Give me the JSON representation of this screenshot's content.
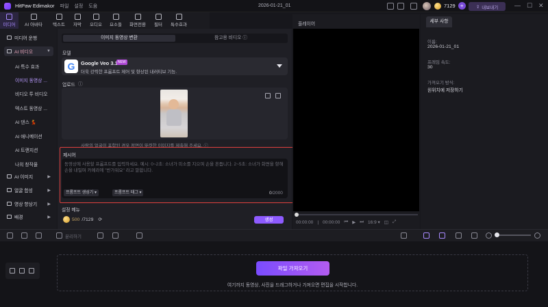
{
  "titlebar": {
    "app_name": "HitPaw Edimakor",
    "menu": [
      "파일",
      "설정",
      "도움"
    ],
    "project_date": "2026-01-21_01",
    "credits": "7129",
    "export_label": "내보내기"
  },
  "toolbar": {
    "items": [
      {
        "label": "미디어",
        "icon": "media-icon",
        "active": true
      },
      {
        "label": "AI 아바타",
        "icon": "avatar-icon"
      },
      {
        "label": "텍스트",
        "icon": "text-icon"
      },
      {
        "label": "자막",
        "icon": "subtitle-icon"
      },
      {
        "label": "오디오",
        "icon": "audio-icon"
      },
      {
        "label": "요소들",
        "icon": "elements-icon"
      },
      {
        "label": "화면전환",
        "icon": "transition-icon"
      },
      {
        "label": "필터",
        "icon": "filter-icon"
      },
      {
        "label": "특수효과",
        "icon": "effects-icon"
      }
    ]
  },
  "sidebar": {
    "groups": [
      {
        "label": "미디어 운행"
      },
      {
        "label": "AI 비디오"
      },
      {
        "label": "AI 이미지"
      },
      {
        "label": "얼굴 합성"
      },
      {
        "label": "영상 향상기"
      },
      {
        "label": "배경"
      }
    ],
    "items": [
      {
        "label": "AI 특수 효과"
      },
      {
        "label": "이미지 동영상 ..."
      },
      {
        "label": "비디오 투 비디오"
      },
      {
        "label": "텍스트 동영상 ..."
      },
      {
        "label": "AI 댄스 💃"
      },
      {
        "label": "AI 애니메이션"
      },
      {
        "label": "AI 트랜지션"
      },
      {
        "label": "나의 창작물"
      }
    ]
  },
  "panel": {
    "tabs": [
      "이미지 동영상 변환",
      "참고용 비디오"
    ],
    "model_label": "모델",
    "model_name": "Google Veo 3.1",
    "model_badge": "NEW",
    "model_desc": "더욱 강력한 프롬프트 제어 및 향상된 내러티브 기능.",
    "upload_label": "업로드",
    "warning": "사람의 얼굴이 포함된 경우 정면이 뚜렷한 이미지를 제출해 주세요.",
    "prompt_label": "제시어",
    "prompt_placeholder": "동영상에 사용할 프롬프트를 입력하세요. 예시: 0~2초: 소녀가 미소를 지으며 손을 흔듭니다. 2~5초: 소녀가 화면을 향해 손을 내밀며 카메라에 \"반가워요\" 라고 말합니다.",
    "prompt_gen_btn": "프롬프트 생성기",
    "prompt_tag_btn": "프롬프트 태그",
    "char_count": "0",
    "char_max": "/2000",
    "setting_label": "설정 메뉴",
    "cost": "500",
    "cost_total": "/7129",
    "generate_btn": "생성"
  },
  "player": {
    "title": "플레이어",
    "time_current": "00:00:00",
    "time_total": "00:00:00",
    "ratio": "16:9"
  },
  "details": {
    "tab": "세부 사항",
    "name_label": "이름:",
    "name_value": "2026-01-21_01",
    "fps_label": "프레임 속도:",
    "fps_value": "30",
    "import_label": "가져오기 방식:",
    "import_value": "원위치에 저장하기"
  },
  "timeline": {
    "split_label": "분리하기",
    "import_button": "파일 가져오기",
    "drop_hint": "여기까지 동영상, 사진을 드래그하거나 가져오면 편집을 시작합니다."
  },
  "colors": {
    "accent": "#8e5bff",
    "highlight_border": "#e0413f"
  }
}
